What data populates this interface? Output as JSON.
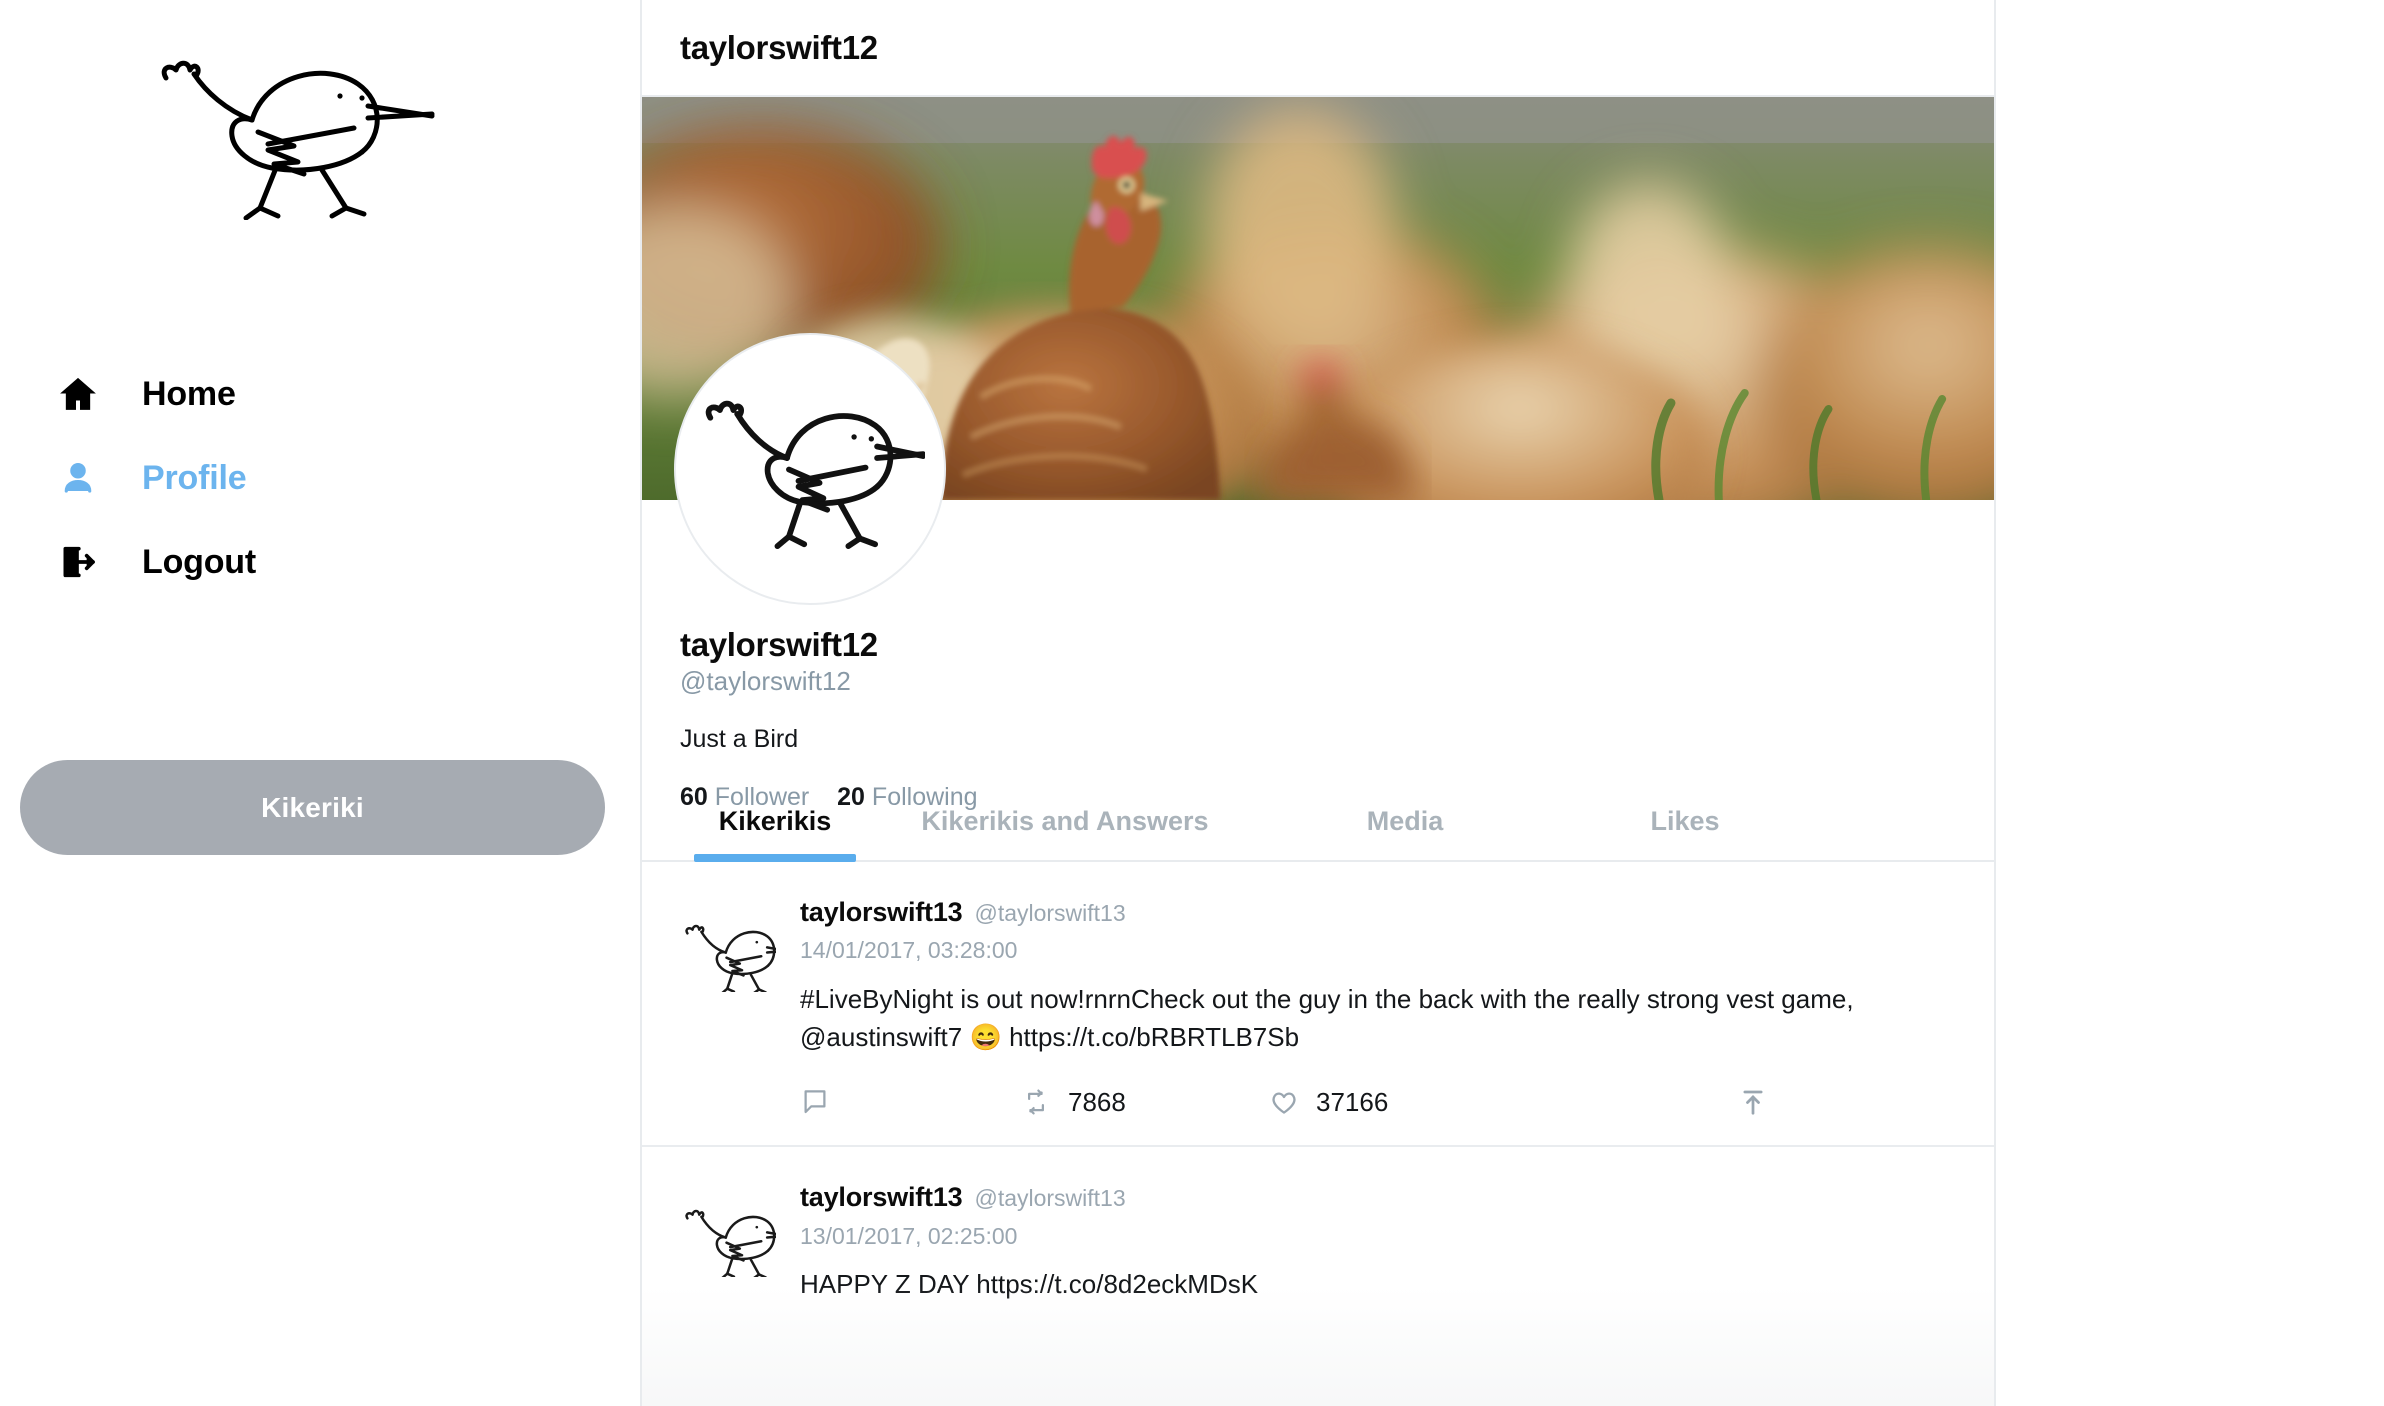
{
  "sidebar": {
    "logo_alt": "bird-logo",
    "nav": [
      {
        "label": "Home",
        "icon": "home-icon",
        "active": false
      },
      {
        "label": "Profile",
        "icon": "person-icon",
        "active": true
      },
      {
        "label": "Logout",
        "icon": "logout-icon",
        "active": false
      }
    ],
    "compose_button": "Kikeriki"
  },
  "header": {
    "title": "taylorswift12"
  },
  "profile": {
    "banner_alt": "chickens-on-grass-banner",
    "avatar_alt": "bird-avatar",
    "name": "taylorswift12",
    "handle": "@taylorswift12",
    "bio": "Just a Bird",
    "followers_count": "60",
    "followers_label": "Follower",
    "following_count": "20",
    "following_label": "Following"
  },
  "tabs": [
    {
      "label": "Kikerikis",
      "active": true
    },
    {
      "label": "Kikerikis and Answers",
      "active": false
    },
    {
      "label": "Media",
      "active": false
    },
    {
      "label": "Likes",
      "active": false
    }
  ],
  "posts": [
    {
      "author": "taylorswift13",
      "handle": "@taylorswift13",
      "date": "14/01/2017, 03:28:00",
      "text_before_emoji": "#LiveByNight is out now!rnrnCheck out the guy in the back with the really strong vest game, @austinswift7 ",
      "emoji": "😄",
      "text_after_emoji": " https://t.co/bRBRTLB7Sb",
      "reply_count": "",
      "retweet_count": "7868",
      "like_count": "37166"
    },
    {
      "author": "taylorswift13",
      "handle": "@taylorswift13",
      "date": "13/01/2017, 02:25:00",
      "text_before_emoji": "HAPPY Z DAY https://t.co/8d2eckMDsK",
      "emoji": "",
      "text_after_emoji": "",
      "reply_count": "",
      "retweet_count": "",
      "like_count": ""
    }
  ],
  "colors": {
    "accent_blue": "#6cb4ee",
    "tab_underline": "#5aaded",
    "muted": "#8899a6",
    "compose_button_bg": "#a6abb2"
  }
}
